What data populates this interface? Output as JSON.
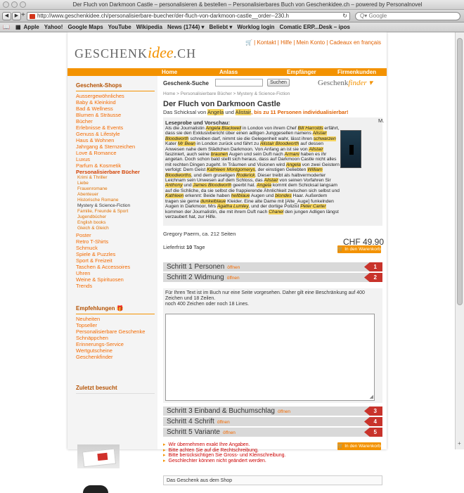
{
  "window": {
    "title": "Der Fluch von Darkmoon Castle – personalisieren & bestellen – Personalisierbares Buch von Geschenkidee.ch – powered by Personalnovel"
  },
  "toolbar": {
    "url": "http://www.geschenkidee.ch/personalisierbare-buecher/der-fluch-von-darkmoon-castle__order--230.h",
    "search_placeholder": "Q▾ Google"
  },
  "bookmarks": [
    "Apple",
    "Yahoo!",
    "Google Maps",
    "YouTube",
    "Wikipedia",
    "News (1744) ▾",
    "Beliebt ▾",
    "Worklog login",
    "Comatic ERP...Desk – ipos"
  ],
  "logo": {
    "part1": "GESCHENK",
    "part2": "idee",
    "part3": ".CH"
  },
  "toplinks": "🛒 | Kontakt | Hilfe | Mein Konto | Cadeaux en français",
  "nav": [
    "Home",
    "Anlass",
    "Empfänger",
    "Firmenkunden"
  ],
  "sidebar": {
    "shops_title": "Geschenk-Shops",
    "shops": [
      {
        "label": "Aussergewöhnliches"
      },
      {
        "label": "Baby & Kleinkind"
      },
      {
        "label": "Bad & Wellness"
      },
      {
        "label": "Blumen & Sträusse"
      },
      {
        "label": "Bücher"
      },
      {
        "label": "Erlebnisse & Events"
      },
      {
        "label": "Genuss & Lifestyle"
      },
      {
        "label": "Haus & Wohnen"
      },
      {
        "label": "Jahrgang & Sternzeichen"
      },
      {
        "label": "Love & Romance"
      },
      {
        "label": "Luxus"
      },
      {
        "label": "Parfum & Kosmetik"
      }
    ],
    "active_shop": "Personalisierbare Bücher",
    "subcats": [
      {
        "label": "Krimi & Thriller",
        "sel": false
      },
      {
        "label": "Liebe",
        "sel": false
      },
      {
        "label": "Frauenromane",
        "sel": false
      },
      {
        "label": "Abenteuer",
        "sel": false
      },
      {
        "label": "Historische Romane",
        "sel": false
      },
      {
        "label": "Mystery & Science-Fiction",
        "sel": true
      },
      {
        "label": "Familie, Freunde & Sport",
        "sel": false
      },
      {
        "label": "Jugendbücher",
        "sel": false
      },
      {
        "label": "English books",
        "sel": false
      },
      {
        "label": "Gleich & Gleich",
        "sel": false
      }
    ],
    "shops2": [
      {
        "label": "Poster"
      },
      {
        "label": "Retro T-Shirts"
      },
      {
        "label": "Schmuck"
      },
      {
        "label": "Spiele & Puzzles"
      },
      {
        "label": "Sport & Freizeit"
      },
      {
        "label": "Taschen & Accessoires"
      },
      {
        "label": "Uhren"
      },
      {
        "label": "Weine & Spirituosen"
      },
      {
        "label": "Trends"
      }
    ],
    "reco_title": "Empfehlungen",
    "reco": [
      {
        "label": "Neuheiten"
      },
      {
        "label": "Topseller"
      },
      {
        "label": "Personalisierbare Geschenke"
      },
      {
        "label": "Schnäppchen"
      },
      {
        "label": "Erinnerungs-Service"
      },
      {
        "label": "Wertgutscheine"
      },
      {
        "label": "Geschenkfinder"
      }
    ],
    "recent_title": "Zuletzt besucht"
  },
  "search": {
    "label": "Geschenk-Suche",
    "button": "Suchen",
    "finder_a": "Geschenk",
    "finder_b": "finder ▾"
  },
  "breadcrumb": "Home > Personalisierbare Bücher > Mystery & Science-Fiction",
  "product": {
    "title": "Der Fluch von Darkmoon Castle",
    "tag_pre": "Das Schicksal von ",
    "tag_n1": "Angela",
    "tag_mid": " und ",
    "tag_n2": "Alistair",
    "tag_post": ", bis zu 11 Personen individualisierbar!",
    "preview_title": "Leseprobe und Vorschau:",
    "preview_html": "Als die Journalistin <i>Angela Blackwell</i> in London von ihrem Chef <i>Bill Harrolds</i> erfährt, dass sie den Exklusivbericht über einen adligen Junggesellen namens <i>Alistair Bloodworth</i> schreiben darf, nimmt sie die Gelegenheit wahr, lässt ihren <i>schwarzen</i> Kater <i>Mr Bean</i> in London zurück und fährt zu <i>Alistair Bloodworth</i> auf dessen Anwesen nahe dem Städtchen Darkmoon. Von Anfang an ist sie von <i>Alistair</i> fasziniert, auch seine <i>braunen</i> Augen und sein Duft nach <i>Armani</i> haben es ihr angetan. Doch schon bald stellt sich heraus, dass auf Darkmoon Castle nicht alles mit rechten Dingen zugeht. In Träumen und Visionen wird <i>Angela</i> von zwei Geistern verfolgt: Dem Geist <i>Kathleen Montgomerys</i>, der einstigen Geliebten <i>William Bloodworths</i>, und dem gruseligen <i>Roderick</i>. Dieser treibt als halbvermoderter Leichnam sein Unwesen auf dem Schloss, das <i>Alistair</i> von seinen Vorfahren Sir <i>Anthony</i> und <i>James Bloodworth</i> geerbt hat. <i>Angela</i> kommt dem Schicksal langsam auf die Schliche, da sie selbst die frappierende Ähnlichkeit zwischen sich selbst und <i>Kathleen</i> erkennt: Beide haben <i>hellblaue</i> Augen und <i>blondes</i> Haar. Außerdem tragen sie gerne <i>dunkelblaue</i> Kleider. Eine alte Dame mit [Alte_Auge] funkelnden Augen in Darkmoor, Mrs <i>Agatha Lumley</i>, und der dortige Polizist <i>Peter Carter</i> kommen der Journalistin, die mit ihrem Duft nach <i>Chanel</i> den jungen Adligen längst verzaubert hat, zur Hilfe.",
    "m_marker": "M.",
    "author": "Gregory Paerm, ca. 212 Seiten",
    "price": "CHF 49.90",
    "delivery_pre": "Lieferfrist ",
    "delivery_days": "10",
    "delivery_post": " Tage",
    "cart": "🛒 In den Warenkorb"
  },
  "steps": [
    {
      "label": "Schritt 1 Personen",
      "open": "öffnen",
      "num": "1"
    },
    {
      "label": "Schritt 2 Widmung",
      "open": "öffnen",
      "num": "2"
    },
    {
      "label": "Schritt 3 Einband & Buchumschlag",
      "open": "öffnen",
      "num": "3"
    },
    {
      "label": "Schritt 4 Schrift",
      "open": "öffnen",
      "num": "4"
    },
    {
      "label": "Schritt 5 Variante",
      "open": "öffnen",
      "num": "5"
    }
  ],
  "widmung": {
    "text1": "Für Ihren Text ist im Buch nur eine Seite vorgesehen. Daher gilt eine Beschränkung auf 400 Zeichen und 18 Zeilen.",
    "text2": "noch 400 Zeichen oder noch 18 Lines."
  },
  "notes": [
    "Wir übernehmen exakt Ihre Angaben.",
    "Bitte achten Sie auf die Rechtschreibung.",
    "Bitte berücksichtigen Sie Gross- und Kleinschreibung.",
    "Geschlechter können nicht geändert werden."
  ],
  "giftbox": "Das Geschenk aus dem Shop"
}
